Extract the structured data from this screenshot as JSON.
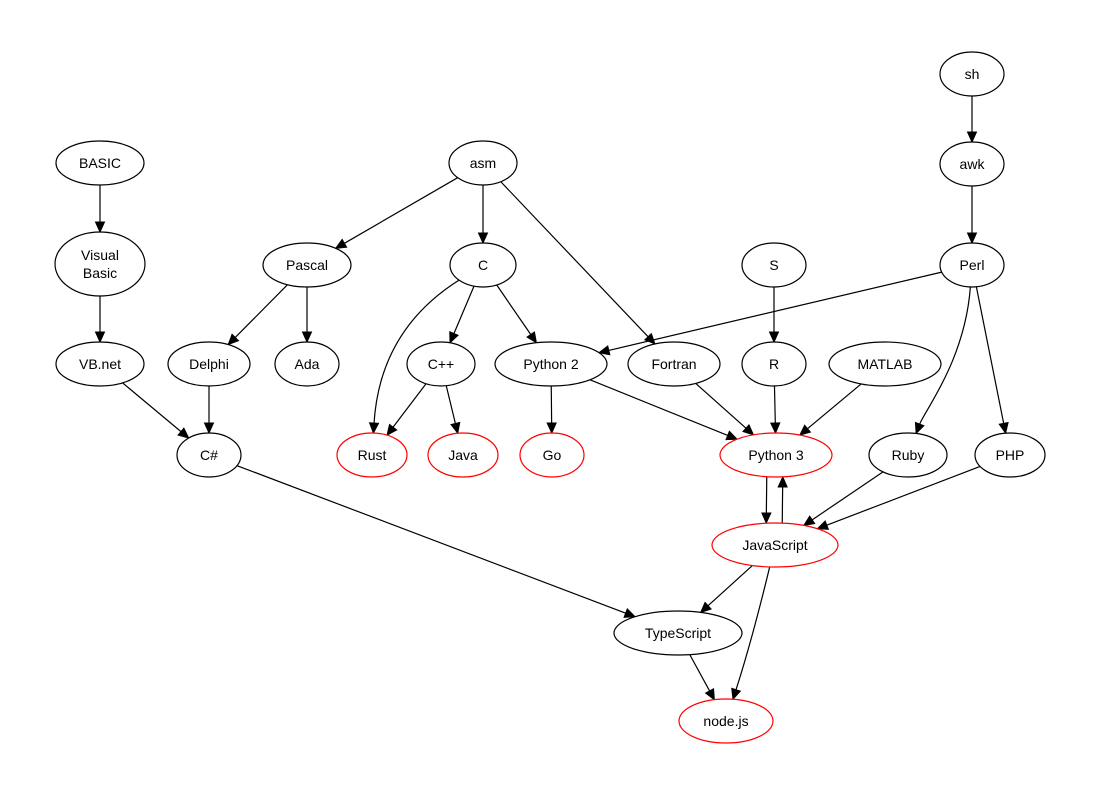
{
  "colors": {
    "default": "#000000",
    "highlight": "#ff0000",
    "background": "#ffffff"
  },
  "nodes": [
    {
      "id": "sh",
      "label": "sh"
    },
    {
      "id": "awk",
      "label": "awk"
    },
    {
      "id": "perl",
      "label": "Perl"
    },
    {
      "id": "basic",
      "label": "BASIC"
    },
    {
      "id": "vb",
      "label": "Visual\nBasic"
    },
    {
      "id": "vbnet",
      "label": "VB.net"
    },
    {
      "id": "asm",
      "label": "asm"
    },
    {
      "id": "pascal",
      "label": "Pascal"
    },
    {
      "id": "c",
      "label": "C"
    },
    {
      "id": "s",
      "label": "S"
    },
    {
      "id": "delphi",
      "label": "Delphi"
    },
    {
      "id": "ada",
      "label": "Ada"
    },
    {
      "id": "cpp",
      "label": "C++"
    },
    {
      "id": "python2",
      "label": "Python 2"
    },
    {
      "id": "fortran",
      "label": "Fortran"
    },
    {
      "id": "r",
      "label": "R"
    },
    {
      "id": "matlab",
      "label": "MATLAB"
    },
    {
      "id": "csharp",
      "label": "C#"
    },
    {
      "id": "rust",
      "label": "Rust",
      "highlight": true
    },
    {
      "id": "java",
      "label": "Java",
      "highlight": true
    },
    {
      "id": "go",
      "label": "Go",
      "highlight": true
    },
    {
      "id": "python3",
      "label": "Python 3",
      "highlight": true
    },
    {
      "id": "ruby",
      "label": "Ruby"
    },
    {
      "id": "php",
      "label": "PHP"
    },
    {
      "id": "javascript",
      "label": "JavaScript",
      "highlight": true
    },
    {
      "id": "typescript",
      "label": "TypeScript"
    },
    {
      "id": "nodejs",
      "label": "node.js",
      "highlight": true
    }
  ],
  "edges": [
    [
      "sh",
      "awk"
    ],
    [
      "awk",
      "perl"
    ],
    [
      "basic",
      "vb"
    ],
    [
      "vb",
      "vbnet"
    ],
    [
      "vbnet",
      "csharp"
    ],
    [
      "asm",
      "pascal"
    ],
    [
      "asm",
      "c"
    ],
    [
      "asm",
      "fortran"
    ],
    [
      "pascal",
      "delphi"
    ],
    [
      "pascal",
      "ada"
    ],
    [
      "delphi",
      "csharp"
    ],
    [
      "c",
      "rust"
    ],
    [
      "c",
      "cpp"
    ],
    [
      "c",
      "python2"
    ],
    [
      "cpp",
      "rust"
    ],
    [
      "cpp",
      "java"
    ],
    [
      "python2",
      "go"
    ],
    [
      "python2",
      "python3"
    ],
    [
      "perl",
      "python2"
    ],
    [
      "perl",
      "ruby"
    ],
    [
      "perl",
      "php"
    ],
    [
      "s",
      "r"
    ],
    [
      "r",
      "python3"
    ],
    [
      "fortran",
      "python3"
    ],
    [
      "matlab",
      "python3"
    ],
    [
      "python3",
      "javascript"
    ],
    [
      "javascript",
      "python3"
    ],
    [
      "ruby",
      "javascript"
    ],
    [
      "php",
      "javascript"
    ],
    [
      "csharp",
      "typescript"
    ],
    [
      "javascript",
      "typescript"
    ],
    [
      "javascript",
      "nodejs"
    ],
    [
      "typescript",
      "nodejs"
    ]
  ]
}
